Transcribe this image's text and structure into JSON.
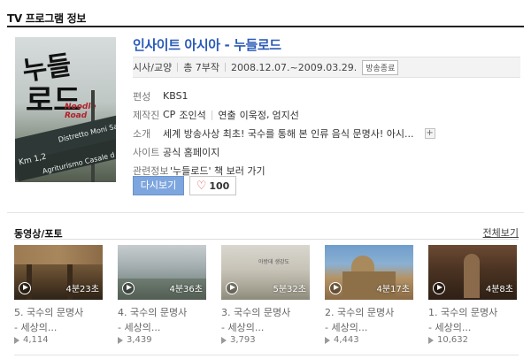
{
  "section": {
    "title": "TV 프로그램 정보"
  },
  "poster": {
    "brush_line1": "누들",
    "brush_line2": "로드",
    "english_title": "Noodle Road",
    "sign_km": "Km 1,2",
    "sign_line1": "Distretto Moni Sa",
    "sign_line2": "Agriturismo Casale d"
  },
  "program": {
    "title": "인사이트 아시아 - 누들로드",
    "genre": "시사/교양",
    "episodes_label": "총 7부작",
    "period": "2008.12.07.~2009.03.29.",
    "status_badge": "방송종료"
  },
  "info": {
    "broadcaster_label": "편성",
    "broadcaster": "KBS1",
    "production_label": "제작진",
    "cp_label": "CP",
    "cp": "조인석",
    "director_label": "연출",
    "director1": "이욱정",
    "director_sep": ",",
    "director2": "엄지선",
    "intro_label": "소개",
    "intro": "세계 방송사상 최초! 국수를 통해 본 인류 음식 문명사! 아시...",
    "more_icon": "+",
    "site_label": "사이트",
    "site": "공식 홈페이지",
    "related_label": "관련정보",
    "related": "'누들로드' 책 보러 가기"
  },
  "actions": {
    "replay": "다시보기",
    "like_icon": "♡",
    "like_count": "100"
  },
  "videos": {
    "title": "동영상/포토",
    "view_all": "전체보기",
    "items": [
      {
        "duration": "4분23초",
        "line1": "5. 국수의 문명사",
        "line2": "- 세상의...",
        "views": "4,114",
        "thumb": "warm-wood-scene"
      },
      {
        "duration": "4분36초",
        "line1": "4. 국수의 문명사",
        "line2": "- 세상의...",
        "views": "3,439",
        "thumb": "misty-landscape"
      },
      {
        "duration": "5분32초",
        "line1": "3. 국수의 문명사",
        "line2": "- 세상의...",
        "views": "3,793",
        "thumb": "foggy-field",
        "thumb_text": "아방데 생강도"
      },
      {
        "duration": "4분17초",
        "line1": "2. 국수의 문명사",
        "line2": "- 세상의...",
        "views": "4,443",
        "thumb": "cathedral-city"
      },
      {
        "duration": "4분8초",
        "line1": "1. 국수의 문명사",
        "line2": "- 세상의...",
        "views": "10,632",
        "thumb": "dark-interior"
      }
    ]
  },
  "colors": {
    "link": "#2a5bb8",
    "replay_button": "#7ea6de",
    "heart": "#e0474e"
  }
}
